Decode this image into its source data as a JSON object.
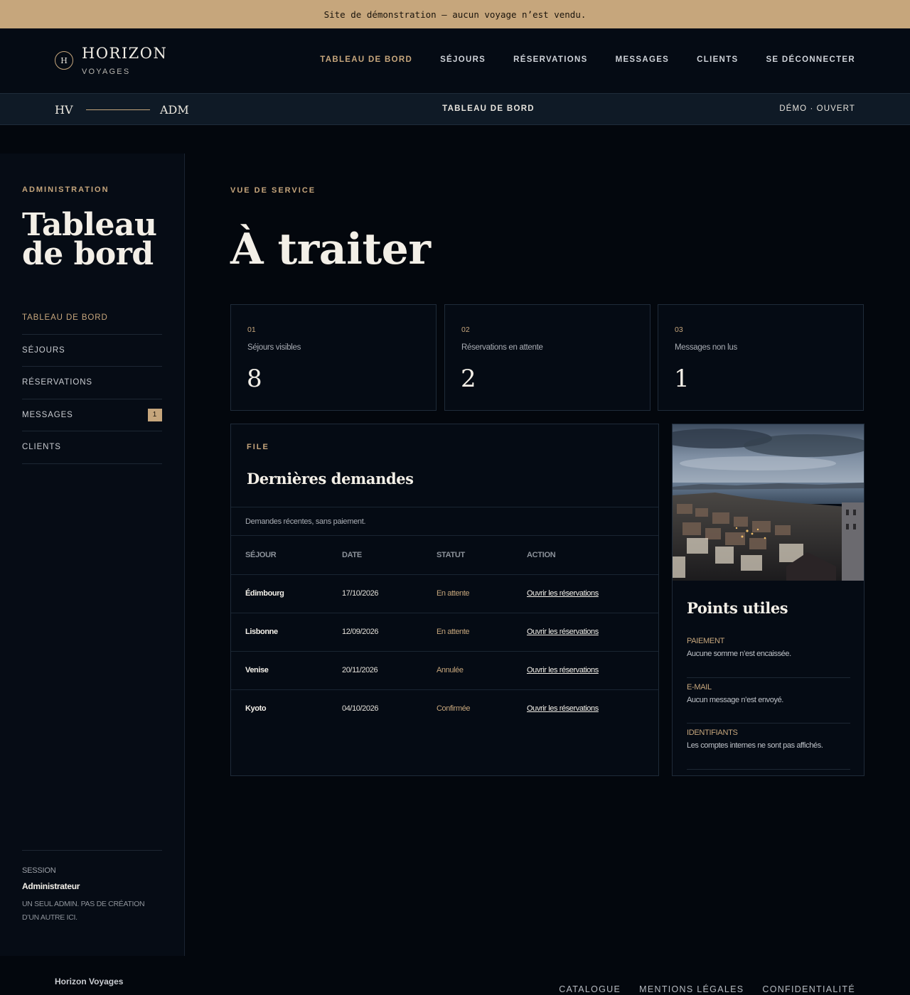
{
  "banner": {
    "text": "Site de démonstration — aucun voyage n’est vendu."
  },
  "brand": {
    "mark": "H",
    "name": "HORIZON",
    "sub": "VOYAGES"
  },
  "topnav": [
    {
      "label": "Tableau de bord",
      "active": true
    },
    {
      "label": "Séjours"
    },
    {
      "label": "Réservations"
    },
    {
      "label": "Messages"
    },
    {
      "label": "Clients"
    },
    {
      "label": "Se déconnecter"
    }
  ],
  "subbar": {
    "left": "HV",
    "right_mark": "ADM",
    "center": "TABLEAU DE BORD",
    "status": "DÉMO · OUVERT"
  },
  "sidebar": {
    "eyebrow": "ADMINISTRATION",
    "title": "Tableau de bord",
    "items": [
      {
        "label": "Tableau de bord",
        "active": true
      },
      {
        "label": "Séjours"
      },
      {
        "label": "Réservations"
      },
      {
        "label": "Messages",
        "badge": "1"
      },
      {
        "label": "Clients"
      }
    ],
    "session": {
      "label": "SESSION",
      "name": "Administrateur",
      "note": "Un seul admin. Pas de création d’un autre ici."
    }
  },
  "main": {
    "eyebrow": "VUE DE SERVICE",
    "title": "À traiter",
    "stats": [
      {
        "num": "01",
        "label": "Séjours visibles",
        "value": "8"
      },
      {
        "num": "02",
        "label": "Réservations en attente",
        "value": "2"
      },
      {
        "num": "03",
        "label": "Messages non lus",
        "value": "1"
      }
    ],
    "requests": {
      "eyebrow": "FILE",
      "title": "Dernières demandes",
      "desc": "Demandes récentes, sans paiement.",
      "columns": [
        "Séjour",
        "Date",
        "Statut",
        "Action"
      ],
      "rows": [
        {
          "sejour": "Édimbourg",
          "date": "17/10/2026",
          "statut": "En attente",
          "action": "Ouvrir les réservations"
        },
        {
          "sejour": "Lisbonne",
          "date": "12/09/2026",
          "statut": "En attente",
          "action": "Ouvrir les réservations"
        },
        {
          "sejour": "Venise",
          "date": "20/11/2026",
          "statut": "Annulée",
          "action": "Ouvrir les réservations"
        },
        {
          "sejour": "Kyoto",
          "date": "04/10/2026",
          "statut": "Confirmée",
          "action": "Ouvrir les réservations"
        }
      ]
    },
    "tips": {
      "title": "Points utiles",
      "items": [
        {
          "label": "Paiement",
          "text": "Aucune somme n’est encaissée."
        },
        {
          "label": "E-mail",
          "text": "Aucun message n’est envoyé."
        },
        {
          "label": "Identifiants",
          "text": "Les comptes internes ne sont pas affichés."
        }
      ]
    }
  },
  "footer": {
    "brand": "Horizon Voyages",
    "links": [
      "Catalogue",
      "Mentions légales",
      "Confidentialité"
    ]
  },
  "colors": {
    "accent": "#c6a67c",
    "background": "#03070d",
    "panel": "#050b14"
  }
}
